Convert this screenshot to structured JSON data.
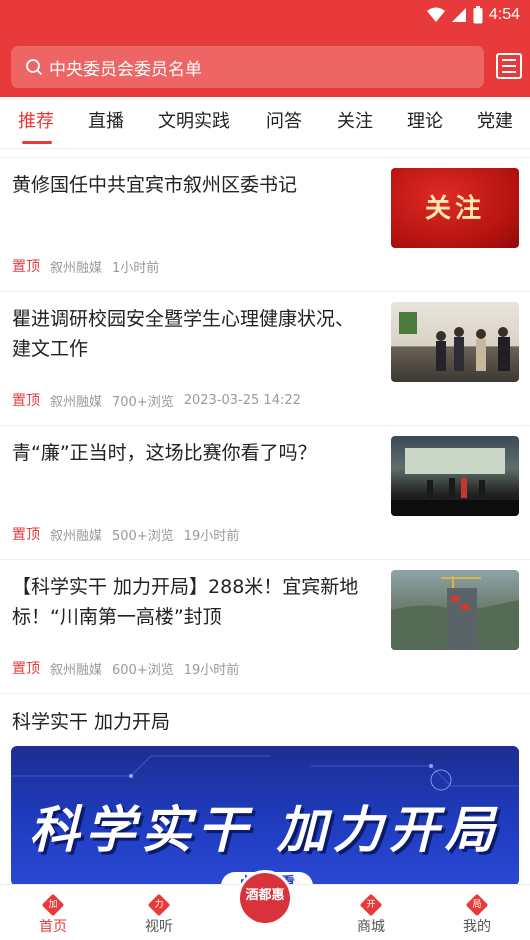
{
  "status_bar": {
    "time": "4:54"
  },
  "search": {
    "placeholder": "中央委员会委员名单",
    "scan_label": "搜索"
  },
  "tabs": [
    {
      "label": "推荐",
      "active": true
    },
    {
      "label": "直播"
    },
    {
      "label": "文明实践"
    },
    {
      "label": "问答"
    },
    {
      "label": "关注"
    },
    {
      "label": "理论"
    },
    {
      "label": "党建"
    }
  ],
  "articles": [
    {
      "title": "黄修国任中共宜宾市叙州区委书记",
      "pin": "置顶",
      "source": "叙州融媒",
      "views": "",
      "time": "1小时前",
      "thumb_text": "关注"
    },
    {
      "title": "瞿进调研校园安全暨学生心理健康状况、建文工作",
      "pin": "置顶",
      "source": "叙州融媒",
      "views": "700+浏览",
      "time": "2023-03-25 14:22",
      "thumb_text": ""
    },
    {
      "title": "青“廉”正当时，这场比赛你看了吗？",
      "pin": "置顶",
      "source": "叙州融媒",
      "views": "500+浏览",
      "time": "19小时前",
      "thumb_text": ""
    },
    {
      "title": "【科学实干 加力开局】288米！宜宾新地标！“川南第一高楼”封顶",
      "pin": "置顶",
      "source": "叙州融媒",
      "views": "600+浏览",
      "time": "19小时前",
      "thumb_text": ""
    }
  ],
  "section": {
    "title": "科学实干 加力开局",
    "banner_text": "科学实干 加力开局",
    "banner_button": "点击查看"
  },
  "bottom_nav": [
    {
      "label": "首页",
      "badge": "加",
      "active": true
    },
    {
      "label": "视听",
      "badge": "力"
    },
    {
      "label": "酒都惠",
      "badge": ""
    },
    {
      "label": "商城",
      "badge": "开"
    },
    {
      "label": "我的",
      "badge": "局"
    }
  ],
  "colors": {
    "accent": "#e83a3a",
    "banner": "#1f3cc0"
  }
}
